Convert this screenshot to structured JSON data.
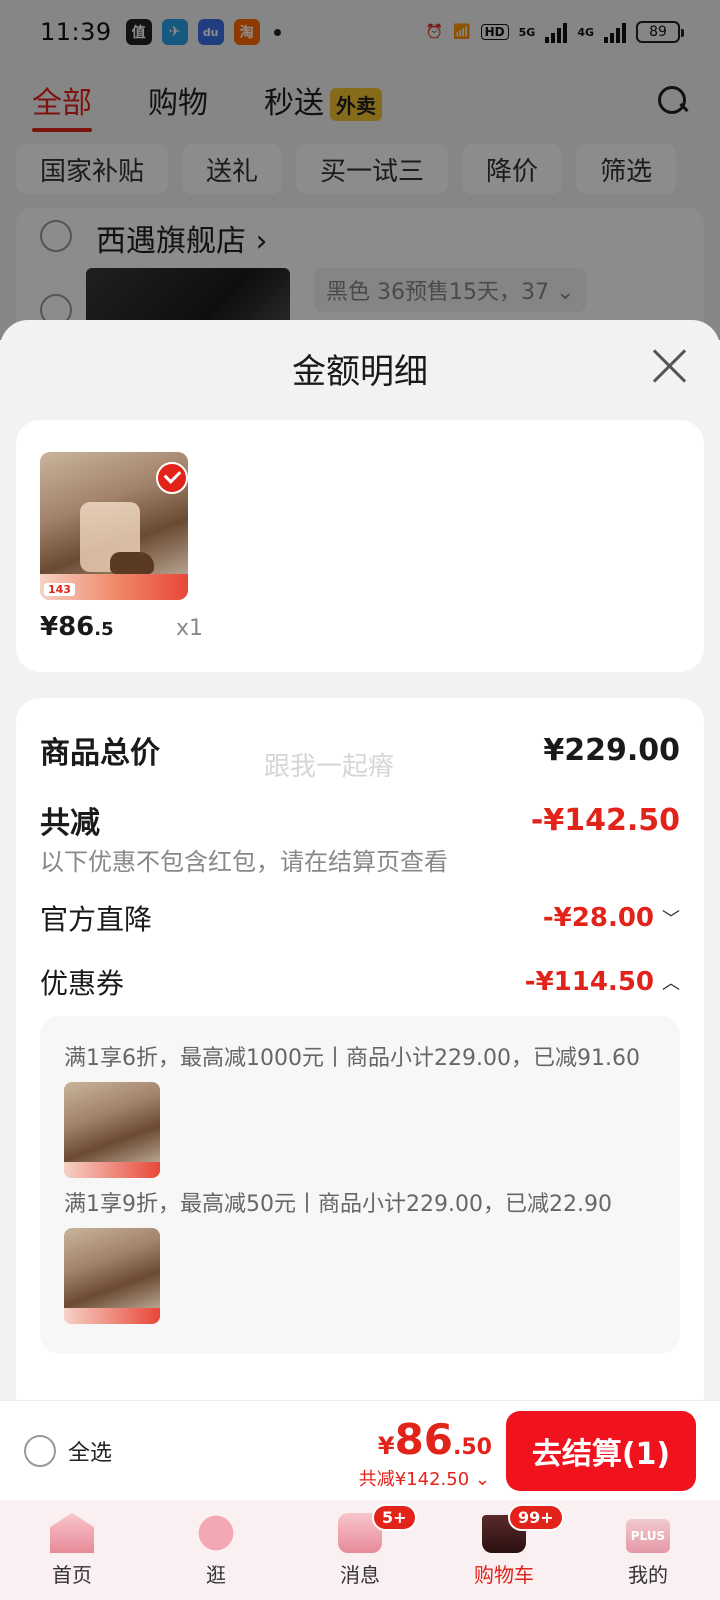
{
  "status_bar": {
    "time": "11:39",
    "apps": [
      {
        "icon": "zhi-app-icon",
        "glyph": "值",
        "color": "#222222"
      },
      {
        "icon": "telegram-app-icon",
        "glyph": "✈",
        "color": "#2aa3e6"
      },
      {
        "icon": "baidu-app-icon",
        "glyph": "du",
        "color": "#3a6fe8"
      },
      {
        "icon": "taobao-app-icon",
        "glyph": "淘",
        "color": "#ff6a00"
      }
    ],
    "network_5g": "5G",
    "network_4g": "4G",
    "hd": "HD",
    "battery": "89"
  },
  "top_tabs": {
    "all": "全部",
    "shopping": "购物",
    "instant": "秒送",
    "waimai_badge": "外卖"
  },
  "filters": [
    "国家补贴",
    "送礼",
    "买一试三",
    "降价",
    "筛选"
  ],
  "store": {
    "name": "西遇旗舰店",
    "sku": "黑色 36预售15天，37"
  },
  "sheet": {
    "title": "金额明细",
    "product": {
      "price_int": "¥86",
      "price_dec": ".5",
      "qty": "x1",
      "promo_price": "143"
    },
    "watermark": "跟我一起瘠",
    "rows": {
      "total_label": "商品总价",
      "total_value": "¥229.00",
      "reduce_label": "共减",
      "reduce_value": "-¥142.50",
      "reduce_note": "以下优惠不包含红包，请在结算页查看",
      "official_label": "官方直降",
      "official_value": "-¥28.00",
      "coupon_label": "优惠券",
      "coupon_value": "-¥114.50"
    },
    "coupons": [
      "满1享6折，最高减1000元丨商品小计229.00，已减91.60",
      "满1享9折，最高减50元丨商品小计229.00，已减22.90"
    ]
  },
  "checkout": {
    "select_all": "全选",
    "currency": "¥",
    "price_int": "86",
    "price_dec": ".50",
    "saved": "共减¥142.50",
    "button": "去结算(1)"
  },
  "nav": {
    "home": "首页",
    "guang": "逛",
    "messages": "消息",
    "messages_badge": "5+",
    "cart": "购物车",
    "cart_badge": "99+",
    "plus": "PLUS",
    "mine": "我的"
  }
}
